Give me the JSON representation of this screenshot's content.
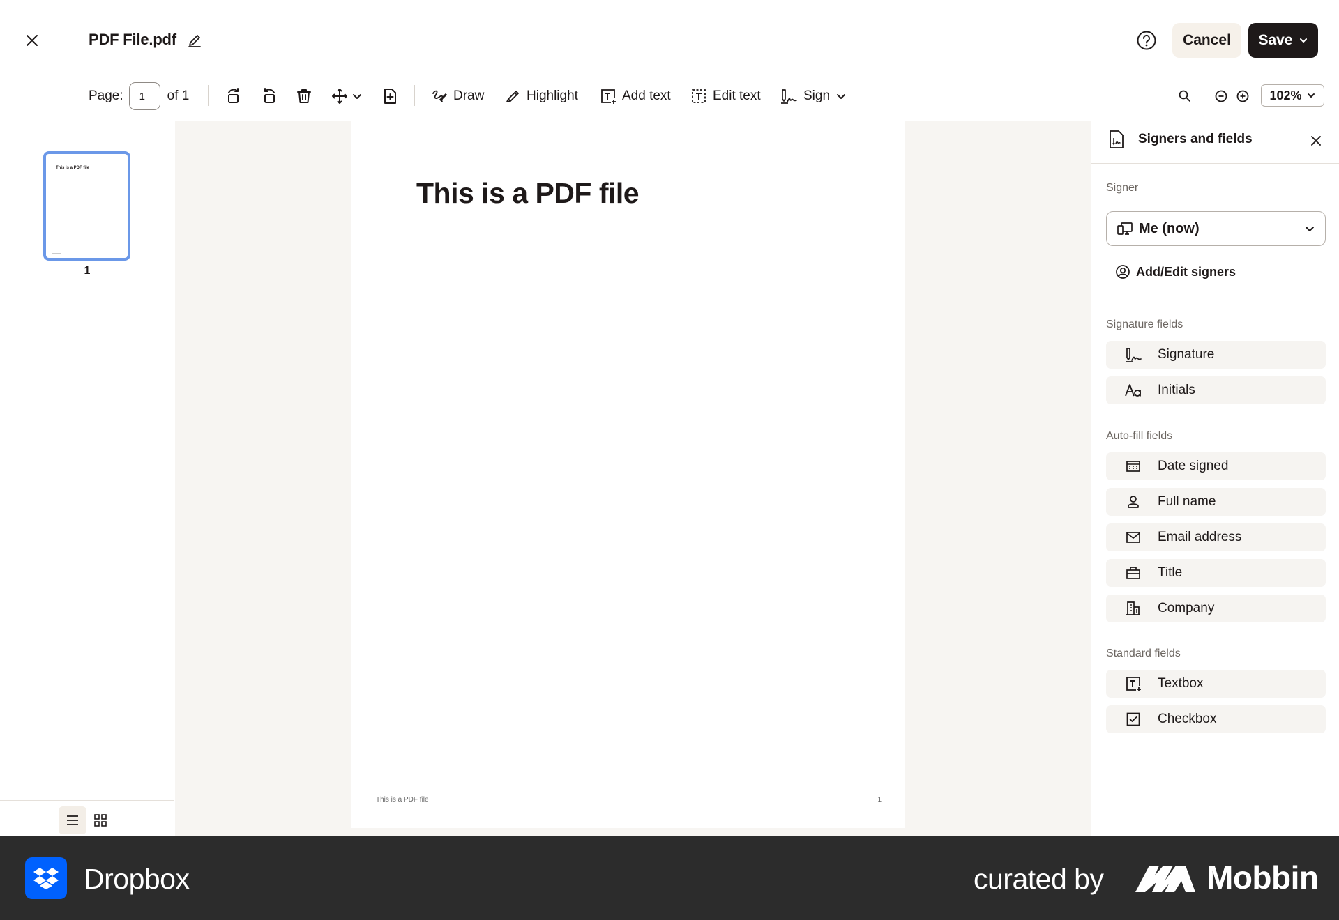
{
  "header": {
    "file_name": "PDF File.pdf",
    "cancel_label": "Cancel",
    "save_label": "Save"
  },
  "toolbar": {
    "page_label": "Page:",
    "page_value": "1",
    "page_of": "of 1",
    "draw_label": "Draw",
    "highlight_label": "Highlight",
    "add_text_label": "Add text",
    "edit_text_label": "Edit text",
    "sign_label": "Sign",
    "zoom_value": "102%"
  },
  "thumbnails": {
    "items": [
      {
        "title": "This is a PDF file",
        "page_number": "1"
      }
    ]
  },
  "document": {
    "heading": "This is a PDF file",
    "footer_text": "This is a PDF file",
    "footer_page": "1"
  },
  "panel": {
    "title": "Signers and fields",
    "signer_label": "Signer",
    "signer_value": "Me (now)",
    "add_signers_label": "Add/Edit signers",
    "signature_fields_label": "Signature fields",
    "signature_fields": [
      {
        "label": "Signature",
        "icon": "signature-icon"
      },
      {
        "label": "Initials",
        "icon": "initials-icon"
      }
    ],
    "autofill_label": "Auto-fill fields",
    "autofill_fields": [
      {
        "label": "Date signed",
        "icon": "calendar-icon"
      },
      {
        "label": "Full name",
        "icon": "person-icon"
      },
      {
        "label": "Email address",
        "icon": "envelope-icon"
      },
      {
        "label": "Title",
        "icon": "briefcase-icon"
      },
      {
        "label": "Company",
        "icon": "building-icon"
      }
    ],
    "standard_label": "Standard fields",
    "standard_fields": [
      {
        "label": "Textbox",
        "icon": "textbox-icon"
      },
      {
        "label": "Checkbox",
        "icon": "checkbox-icon"
      }
    ]
  },
  "banner": {
    "brand": "Dropbox",
    "curated_by": "curated by",
    "curator": "Mobbin"
  },
  "colors": {
    "accent_blue": "#0061fe",
    "thumb_border": "#6b98e8",
    "save_bg": "#1e1919",
    "cancel_bg": "#f6f1ea",
    "banner_bg": "#2c2c2c"
  }
}
